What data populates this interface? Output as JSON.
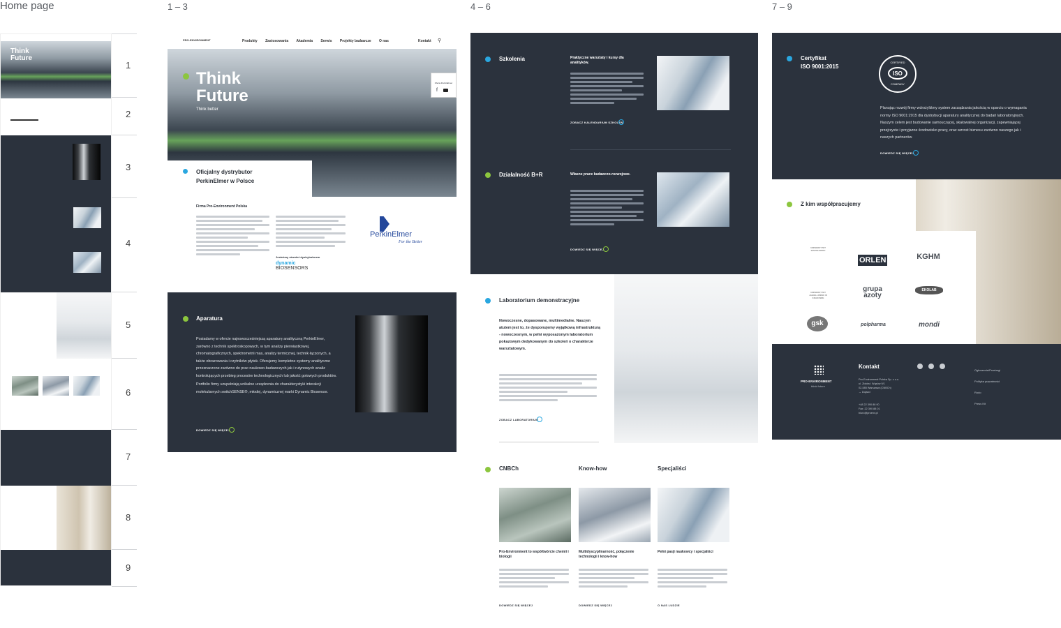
{
  "columns": {
    "home": "Home page",
    "c1": "1 – 3",
    "c2": "4 – 6",
    "c3": "7 – 9"
  },
  "row_numbers": [
    "1",
    "2",
    "3",
    "4",
    "5",
    "6",
    "7",
    "8",
    "9"
  ],
  "colors": {
    "dark": "#2b323d",
    "green": "#8cc63e",
    "blue": "#2aa7e0"
  },
  "nav": {
    "logo_name": "PRO-ENVIRONMENT",
    "items": [
      "Produkty",
      "Zastosowania",
      "Akademia",
      "Serwis",
      "Projekty badawcze",
      "O nas"
    ],
    "kontakt": "Kontakt",
    "search_icon": "search-icon"
  },
  "hero": {
    "title_line1": "Think",
    "title_line2": "Future",
    "subtitle": "Think better",
    "side_text": "Oferta PerkinElmer"
  },
  "distributor": {
    "heading": "Oficjalny dystrybutor PerkinElmer w Polsce",
    "firm_title": "Firma Pro-Environment Polska",
    "official_label": "Jesteśmy również dystrybutorem",
    "dynamic": "dynamic",
    "biosensors": "BIOSENSORS",
    "perkin_logo": "PerkinElmer",
    "perkin_tag": "For the Better"
  },
  "aparatura": {
    "heading": "Aparatura",
    "text": "Posiadamy w ofercie najnowocześniejszą aparaturę analityczną PerkinElmer, zarówno z technik spektroskopowych, w tym analizy pierwiastkowej, chromatograficznych, spektrometrii mas, analizy termicznej, technik łączonych, a także obrazowania i czytników płytek. Oferujemy kompletne systemy analityczne przeznaczone zarówno do prac naukowo-badawczych jak i rutynowych analiz kontrolujących przebieg procesów technologicznych lub jakość gotowych produktów.",
    "text2": "Portfolio firmy uzupełniają unikalne urządzenia do charakterystyki interakcji molekularnych switchSENSE®, młodej, dynamicznej marki Dynamic Biosensor.",
    "more": "DOWIEDZ SIĘ WIĘCEJ"
  },
  "szkolenia": {
    "heading": "Szkolenia",
    "sub": "Praktyczne warsztaty i kursy dla analityków.",
    "more": "ZOBACZ KALENDARIUM SZKOLEŃ"
  },
  "br": {
    "heading": "Działalność B+R",
    "sub": "Własne prace badawczo-rozwojowe.",
    "more": "DOWIEDZ SIĘ WIĘCEJ"
  },
  "lab": {
    "heading": "Laboratorium demonstracyjne",
    "bold": "Nowoczesne, dopasowane, multimedialne. Naszym atutem jest to, że dysponujemy wyjątkową infrastrukturą - nowoczesnym, w pełni wyposażonym laboratorium pokazowym dedykowanym do szkoleń o charakterze warsztatowym.",
    "more": "ZOBACZ LABORATORIUM"
  },
  "cards": [
    {
      "heading": "CNBCh",
      "title": "Pro-Environment to współtwórcie chemii i biologii",
      "more": "DOWIEDZ SIĘ WIĘCEJ"
    },
    {
      "heading": "Know-how",
      "title": "Multidyscyplinarność, połączenie technologii i know-how",
      "more": "DOWIEDZ SIĘ WIĘCEJ"
    },
    {
      "heading": "Specjaliści",
      "title": "Pełni pasji naukowcy i specjaliści",
      "more": "O NAS LUDZIE"
    }
  ],
  "iso": {
    "heading_line1": "Certyfikat",
    "heading_line2": "ISO 9001:2015",
    "badge_top": "CERTIFIED",
    "badge_mid": "ISO",
    "badge_bot": "COMPANY",
    "text": "Planując rozwój firmy wdrożyliśmy system zarządzania jakością w oparciu o wymagania normy ISO 9001:2015 dla dystrybucji aparatury analitycznej do badań laboratoryjnych. Naszym celem jest budowanie samouczącej, skalowalnej organizacji, zapewniającej przejrzyste i przyjazne środowisko pracy, oraz wzrost biznesu zarówno naszego jak i naszych partnerów.",
    "more": "DOWIEDZ SIĘ WIĘCEJ"
  },
  "partners": {
    "heading": "Z kim współpracujemy",
    "logos": [
      "UNIWERSYTET WARSZAWSKI",
      "ORLEN",
      "KGHM",
      "UNIWERSYTET JAGIELLOŃSKI W KRAKOWIE",
      "grupa azoty",
      "EKOLAB",
      "gsk",
      "polpharma",
      "mondi"
    ]
  },
  "footer": {
    "logo": "PRO-ENVIRONMENT",
    "tag": "think future",
    "kontakt": "Kontakt",
    "address": [
      "Pro-Environment Polska Sp. z o.o.",
      "ul. Ziołów i Wąsów 9/1",
      "02-585 Warszawa (CNBCh)",
      "→ Dojazd"
    ],
    "phones": [
      "+48 22 390 88 00",
      "Fax: 22 390 88 01",
      "biuro@proenv.pl"
    ],
    "links": [
      "Ogłoszenia/Przetargi",
      "Polityka prywatności",
      "Rodo",
      "Press Kit"
    ],
    "social": [
      "linkedin-icon",
      "facebook-icon",
      "youtube-icon"
    ]
  }
}
